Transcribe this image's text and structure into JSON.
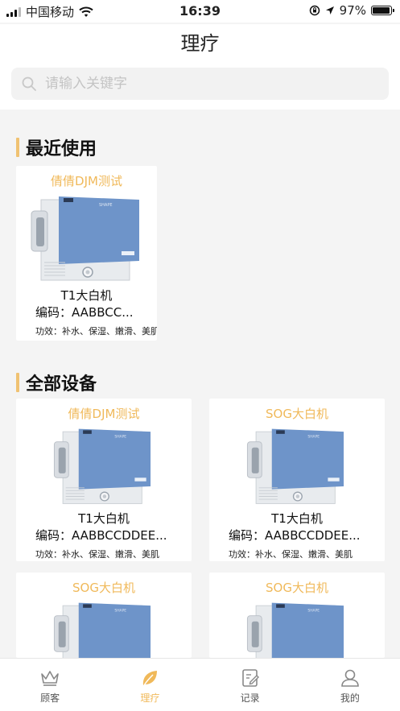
{
  "status_bar": {
    "carrier": "中国移动",
    "time": "16:39",
    "battery": "97%",
    "battery_level": 0.97
  },
  "page": {
    "title": "理疗"
  },
  "search": {
    "placeholder": "请输入关键字"
  },
  "recent": {
    "title": "最近使用",
    "items": [
      {
        "name": "倩倩DJM测试",
        "model": "T1大白机",
        "code": "编码：AABBCC...",
        "effect": "功效：补水、保湿、嫩滑、美肌"
      }
    ]
  },
  "all": {
    "title": "全部设备",
    "items": [
      {
        "name": "倩倩DJM测试",
        "model": "T1大白机",
        "code": "编码：AABBCCDDEE...",
        "effect": "功效：补水、保湿、嫩滑、美肌"
      },
      {
        "name": "SOG大白机",
        "model": "T1大白机",
        "code": "编码：AABBCCDDEE...",
        "effect": "功效：补水、保湿、嫩滑、美肌"
      },
      {
        "name": "SOG大白机"
      },
      {
        "name": "SOG大白机"
      }
    ]
  },
  "tabs": [
    {
      "label": "顾客",
      "icon": "crown-icon",
      "active": false
    },
    {
      "label": "理疗",
      "icon": "leaf-icon",
      "active": true
    },
    {
      "label": "记录",
      "icon": "edit-document-icon",
      "active": false
    },
    {
      "label": "我的",
      "icon": "user-icon",
      "active": false
    }
  ],
  "colors": {
    "accent": "#f0b95a",
    "section_bar": "#f0c272",
    "machine_panel": "#6e94c9"
  }
}
